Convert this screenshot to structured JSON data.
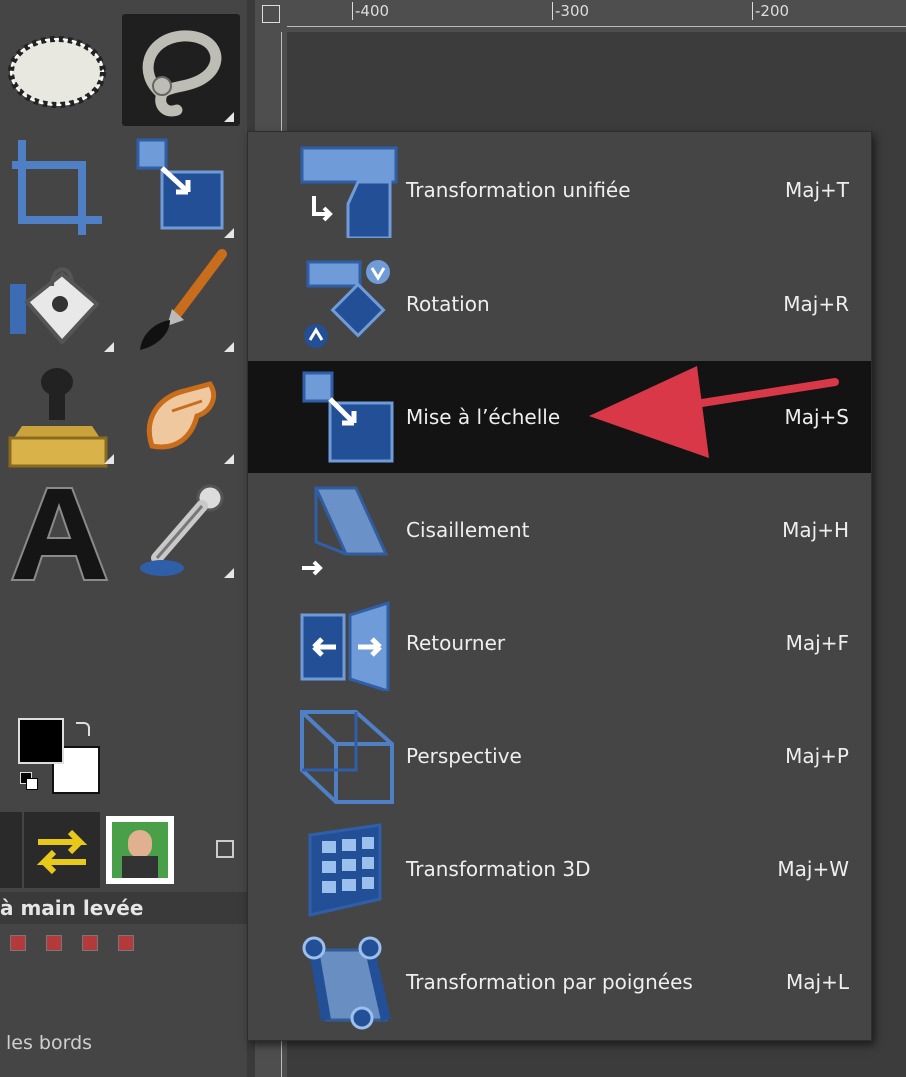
{
  "ruler": {
    "ticks": [
      "-400",
      "-300",
      "-200"
    ]
  },
  "toolbox": {
    "tools": [
      {
        "name": "ellipse-select-tool-icon"
      },
      {
        "name": "free-select-tool-icon"
      },
      {
        "name": "crop-tool-icon"
      },
      {
        "name": "scale-tool-icon"
      },
      {
        "name": "bucket-fill-tool-icon"
      },
      {
        "name": "paintbrush-tool-icon"
      },
      {
        "name": "clone-tool-icon"
      },
      {
        "name": "smudge-tool-icon"
      },
      {
        "name": "text-tool-icon"
      },
      {
        "name": "color-picker-tool-icon"
      }
    ],
    "tool_title": "à main levée",
    "bords_label": "les bords"
  },
  "menu": {
    "items": [
      {
        "label": "Transformation unifiée",
        "shortcut": "Maj+T",
        "icon": "unified-transform-icon"
      },
      {
        "label": "Rotation",
        "shortcut": "Maj+R",
        "icon": "rotate-icon"
      },
      {
        "label": "Mise à l’échelle",
        "shortcut": "Maj+S",
        "icon": "scale-icon",
        "highlighted": true
      },
      {
        "label": "Cisaillement",
        "shortcut": "Maj+H",
        "icon": "shear-icon"
      },
      {
        "label": "Retourner",
        "shortcut": "Maj+F",
        "icon": "flip-icon"
      },
      {
        "label": "Perspective",
        "shortcut": "Maj+P",
        "icon": "perspective-icon"
      },
      {
        "label": "Transformation 3D",
        "shortcut": "Maj+W",
        "icon": "3d-transform-icon"
      },
      {
        "label": "Transformation par poignées",
        "shortcut": "Maj+L",
        "icon": "handle-transform-icon"
      }
    ]
  },
  "colors": {
    "accent_blue": "#2f5fa8",
    "light_blue": "#6f9bd8",
    "arrow_red": "#d93848"
  }
}
